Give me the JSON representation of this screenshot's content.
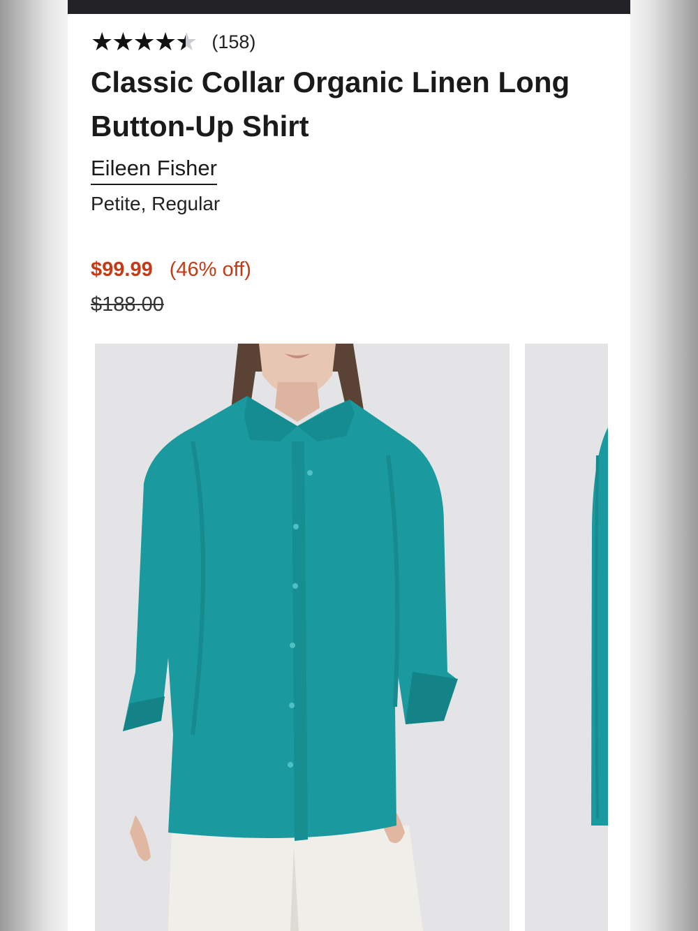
{
  "product": {
    "rating": {
      "value": 4.5,
      "max": 5,
      "stars_glyph": "★★★★★",
      "count_text": "(158)"
    },
    "title": "Classic Collar Organic Linen Long Button-Up Shirt",
    "brand": "Eileen Fisher",
    "sizes": "Petite, Regular",
    "price": {
      "sale": "$99.99",
      "discount": "(46% off)",
      "original": "$188.00"
    }
  },
  "gallery": {
    "images": [
      {
        "name": "model-front-view"
      },
      {
        "name": "model-side-view"
      }
    ],
    "shirt_color": "#1a9a9e"
  },
  "colors": {
    "sale_red": "#c23b16",
    "text": "#1a1a1a",
    "header_bar": "#222226"
  }
}
